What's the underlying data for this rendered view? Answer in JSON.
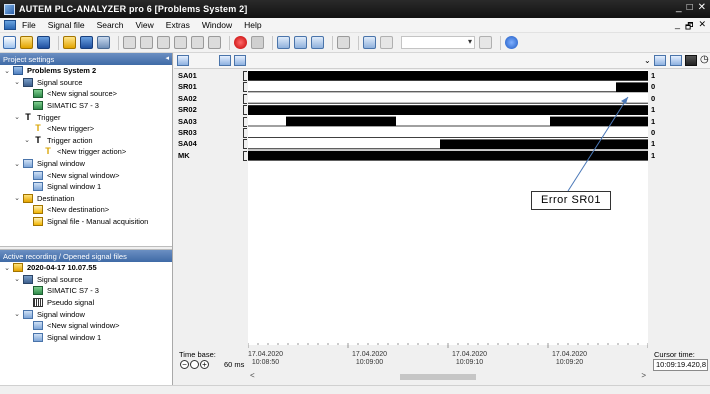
{
  "window": {
    "title": "AUTEM  PLC-ANALYZER pro 6 [Problems System 2]",
    "minimize": "_",
    "close": "✕",
    "mdi_restore": "_  🗗  ✕"
  },
  "menu": [
    "File",
    "Signal file",
    "Search",
    "View",
    "Extras",
    "Window",
    "Help"
  ],
  "project_panel": {
    "header": "Project settings",
    "items": [
      {
        "label": "Problems System 2",
        "indent": 0,
        "chevron": "⌄",
        "icon": "sys",
        "bold": true
      },
      {
        "label": "Signal source",
        "indent": 1,
        "chevron": "⌄",
        "icon": "src"
      },
      {
        "label": "<New signal source>",
        "indent": 2,
        "chevron": "",
        "icon": "plc"
      },
      {
        "label": "SIMATIC S7 - 3",
        "indent": 2,
        "chevron": "",
        "icon": "plc"
      },
      {
        "label": "Trigger",
        "indent": 1,
        "chevron": "⌄",
        "icon": "trg"
      },
      {
        "label": "<New trigger>",
        "indent": 2,
        "chevron": "",
        "icon": "trgy"
      },
      {
        "label": "Trigger action",
        "indent": 2,
        "chevron": "⌄",
        "icon": "trg"
      },
      {
        "label": "<New trigger action>",
        "indent": 3,
        "chevron": "",
        "icon": "trgy"
      },
      {
        "label": "Signal window",
        "indent": 1,
        "chevron": "⌄",
        "icon": "win"
      },
      {
        "label": "<New signal window>",
        "indent": 2,
        "chevron": "",
        "icon": "win"
      },
      {
        "label": "Signal window 1",
        "indent": 2,
        "chevron": "",
        "icon": "win"
      },
      {
        "label": "Destination",
        "indent": 1,
        "chevron": "⌄",
        "icon": "dest"
      },
      {
        "label": "<New destination>",
        "indent": 2,
        "chevron": "",
        "icon": "file"
      },
      {
        "label": "Signal file - Manual acquisition",
        "indent": 2,
        "chevron": "",
        "icon": "file"
      }
    ]
  },
  "recording_panel": {
    "header": "Active recording / Opened signal files",
    "items": [
      {
        "label": "2020-04-17 10.07.55",
        "indent": 0,
        "chevron": "⌄",
        "icon": "rec",
        "bold": true
      },
      {
        "label": "Signal source",
        "indent": 1,
        "chevron": "⌄",
        "icon": "src"
      },
      {
        "label": "SIMATIC S7 - 3",
        "indent": 2,
        "chevron": "",
        "icon": "plc"
      },
      {
        "label": "Pseudo signal",
        "indent": 2,
        "chevron": "",
        "icon": "pseudo"
      },
      {
        "label": "Signal window",
        "indent": 1,
        "chevron": "⌄",
        "icon": "win"
      },
      {
        "label": "<New signal window>",
        "indent": 2,
        "chevron": "",
        "icon": "win"
      },
      {
        "label": "Signal window 1",
        "indent": 2,
        "chevron": "",
        "icon": "win"
      }
    ]
  },
  "signals": [
    {
      "name": "SA01",
      "value": "1",
      "high": [
        [
          0,
          1
        ]
      ]
    },
    {
      "name": "SR01",
      "value": "0",
      "high": [
        [
          0.92,
          1
        ]
      ]
    },
    {
      "name": "SA02",
      "value": "0",
      "high": []
    },
    {
      "name": "SR02",
      "value": "1",
      "high": [
        [
          0,
          1
        ]
      ]
    },
    {
      "name": "SA03",
      "value": "1",
      "high": [
        [
          0.095,
          0.37
        ],
        [
          0.755,
          1
        ]
      ]
    },
    {
      "name": "SR03",
      "value": "0",
      "high": []
    },
    {
      "name": "SA04",
      "value": "1",
      "high": [
        [
          0.48,
          1
        ]
      ]
    },
    {
      "name": "MK",
      "value": "1",
      "high": [
        [
          0,
          1
        ]
      ]
    }
  ],
  "annotation": {
    "text": "Error SR01",
    "target": "SR01"
  },
  "timebase": {
    "label": "Time base:",
    "value": "60 ms",
    "minus": "−",
    "plus": "+"
  },
  "axis_ticks": [
    {
      "date": "17.04.2020",
      "time": "10:08:50",
      "pos": 0.0
    },
    {
      "date": "17.04.2020",
      "time": "10:09:00",
      "pos": 0.25
    },
    {
      "date": "17.04.2020",
      "time": "10:09:10",
      "pos": 0.5
    },
    {
      "date": "17.04.2020",
      "time": "10:09:20",
      "pos": 0.75
    }
  ],
  "cursor": {
    "label": "Cursor time:",
    "value": "10:09:19.420,8"
  },
  "scroll": {
    "left": "<",
    "right": ">"
  }
}
